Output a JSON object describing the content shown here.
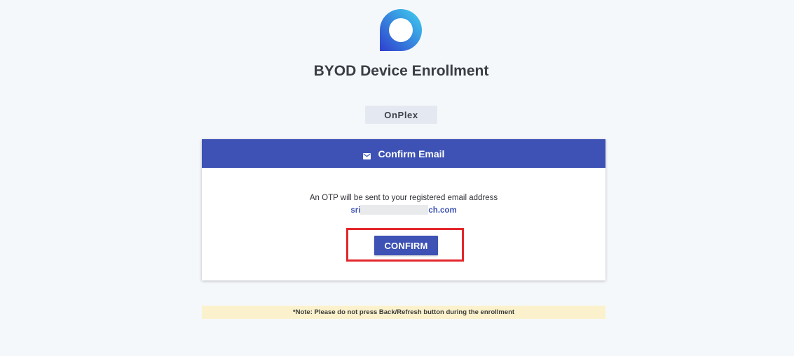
{
  "header": {
    "logo_icon": "onplex-logo-icon",
    "title": "BYOD Device Enrollment",
    "organization": "OnPlex"
  },
  "card": {
    "header_icon": "mail-icon",
    "header_title": "Confirm Email",
    "message": "An OTP will be sent to your registered email address",
    "email_prefix": "sri",
    "email_suffix": "ch.com",
    "confirm_label": "CONFIRM"
  },
  "note": "*Note: Please do not press Back/Refresh button during the enrollment",
  "colors": {
    "brand_blue": "#3d52b4",
    "background": "#f5f8fb",
    "note_background": "#fbf2cd",
    "highlight_red": "#e3262b"
  }
}
